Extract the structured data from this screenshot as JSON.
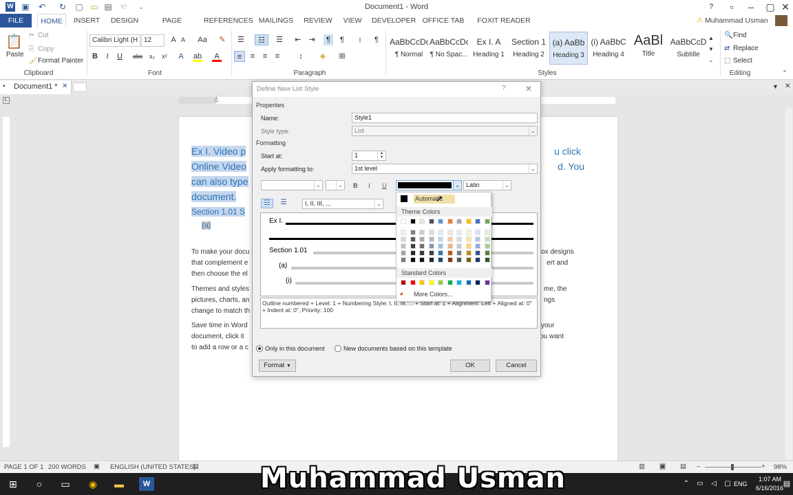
{
  "titlebar": {
    "title": "Document1 - Word",
    "qat": [
      "word-logo-icon",
      "save-icon",
      "undo-icon",
      "redo-icon",
      "new-doc-icon",
      "open-icon",
      "print-icon",
      "touch-mode-icon",
      "customize-qat-icon"
    ]
  },
  "tabs": {
    "file": "FILE",
    "items": [
      "HOME",
      "INSERT",
      "DESIGN",
      "PAGE LAYOUT",
      "REFERENCES",
      "MAILINGS",
      "REVIEW",
      "VIEW",
      "DEVELOPER",
      "OFFICE TAB",
      "FOXIT READER PDF"
    ],
    "user": "Muhammad Usman"
  },
  "ribbon": {
    "clipboard": {
      "paste": "Paste",
      "cut": "Cut",
      "copy": "Copy",
      "format_painter": "Format Painter",
      "label": "Clipboard"
    },
    "font": {
      "name": "Calibri Light (H",
      "size": "12",
      "label": "Font"
    },
    "paragraph": {
      "label": "Paragraph"
    },
    "styles": {
      "label": "Styles",
      "items": [
        {
          "preview": "AaBbCcDc",
          "name": "¶ Normal"
        },
        {
          "preview": "AaBbCcDc",
          "name": "¶ No Spac..."
        },
        {
          "preview": "Ex I. A",
          "name": "Heading 1"
        },
        {
          "preview": "Section 1",
          "name": "Heading 2"
        },
        {
          "preview": "(a) AaBb",
          "name": "Heading 3"
        },
        {
          "preview": "(i) AaBbC",
          "name": "Heading 4"
        },
        {
          "preview": "AaBl",
          "name": "Title"
        },
        {
          "preview": "AaBbCcD",
          "name": "Subtitle"
        }
      ]
    },
    "editing": {
      "find": "Find",
      "replace": "Replace",
      "select": "Select",
      "label": "Editing"
    }
  },
  "doctab": {
    "name": "Document1 *"
  },
  "document": {
    "lines": [
      "Ex I.  Video p",
      "Online Video",
      "can also type",
      "document."
    ],
    "right_lines": [
      "u click",
      "d. You"
    ],
    "section": "Section 1.01  S",
    "sub": "(a)",
    "para1": [
      "To make your docu",
      "that complement e",
      "then choose the el"
    ],
    "para1_right": [
      "ox designs",
      "ert and"
    ],
    "para2": [
      "Themes and styles",
      "pictures, charts, an",
      "change to match th"
    ],
    "para2_right": [
      "me, the",
      "ngs"
    ],
    "para3": [
      "Save time in Word",
      "document, click it",
      "to add a row or a c"
    ],
    "para3_right": [
      "your",
      "ou want"
    ]
  },
  "dialog": {
    "title": "Define New List Style",
    "help": "?",
    "properties": "Properties",
    "name_label": "Name:",
    "name_value": "Style1",
    "styletype_label": "Style type:",
    "styletype_value": "List",
    "formatting": "Formatting",
    "start_label": "Start at:",
    "start_value": "1",
    "apply_label": "Apply formatting to:",
    "apply_value": "1st level",
    "bold": "B",
    "italic": "I",
    "underline": "U",
    "script_value": "Latin",
    "numbering_value": "I, II, III, ...",
    "preview": {
      "l1": "Ex I.",
      "l2": "Section 1.01",
      "l3": "(a)",
      "l4": "(i)"
    },
    "description": "Outline numbered + Level: 1 + Numbering Style: I, II, III, ... + Start at: 1 + Alignment: Left + Aligned at:  0\" + Indent at:  0\", Priority: 100",
    "radio1": "Only in this document",
    "radio2": "New documents based on this template",
    "format_btn": "Format",
    "ok": "OK",
    "cancel": "Cancel"
  },
  "color_picker": {
    "automatic": "Automatic",
    "theme_header": "Theme Colors",
    "standard_header": "Standard Colors",
    "more": "More Colors...",
    "theme_top": [
      "#ffffff",
      "#000000",
      "#e7e6e6",
      "#44546a",
      "#5b9bd5",
      "#ed7d31",
      "#a5a5a5",
      "#ffc000",
      "#4472c4",
      "#70ad47"
    ],
    "theme_shades": [
      [
        "#f2f2f2",
        "#7f7f7f",
        "#d0cece",
        "#d6dce4",
        "#deebf6",
        "#fbe5d5",
        "#ededed",
        "#fff2cc",
        "#d9e2f3",
        "#e2efd9"
      ],
      [
        "#d8d8d8",
        "#595959",
        "#aeabab",
        "#adb9ca",
        "#bdd7ee",
        "#f7cbac",
        "#dbdbdb",
        "#fee599",
        "#b4c6e7",
        "#c5e0b3"
      ],
      [
        "#bfbfbf",
        "#3f3f3f",
        "#757070",
        "#8496b0",
        "#9cc3e5",
        "#f4b183",
        "#c9c9c9",
        "#ffd966",
        "#8eaadb",
        "#a8d08d"
      ],
      [
        "#a5a5a5",
        "#262626",
        "#3a3838",
        "#323f4f",
        "#2e75b5",
        "#c55a11",
        "#7b7b7b",
        "#bf9000",
        "#2f5496",
        "#538135"
      ],
      [
        "#7f7f7f",
        "#0c0c0c",
        "#171616",
        "#222a35",
        "#1e4e79",
        "#833c0b",
        "#525252",
        "#7f6000",
        "#1f3864",
        "#375623"
      ]
    ],
    "standard": [
      "#c00000",
      "#ff0000",
      "#ffc000",
      "#ffff00",
      "#92d050",
      "#00b050",
      "#00b0f0",
      "#0070c0",
      "#002060",
      "#7030a0"
    ]
  },
  "statusbar": {
    "page": "PAGE 1 OF 1",
    "words": "200 WORDS",
    "lang": "ENGLISH (UNITED STATES)",
    "zoom": "98%"
  },
  "taskbar": {
    "lang": "ENG",
    "time": "1:07 AM",
    "date": "6/16/2016"
  },
  "watermark": "Muhammad Usman"
}
